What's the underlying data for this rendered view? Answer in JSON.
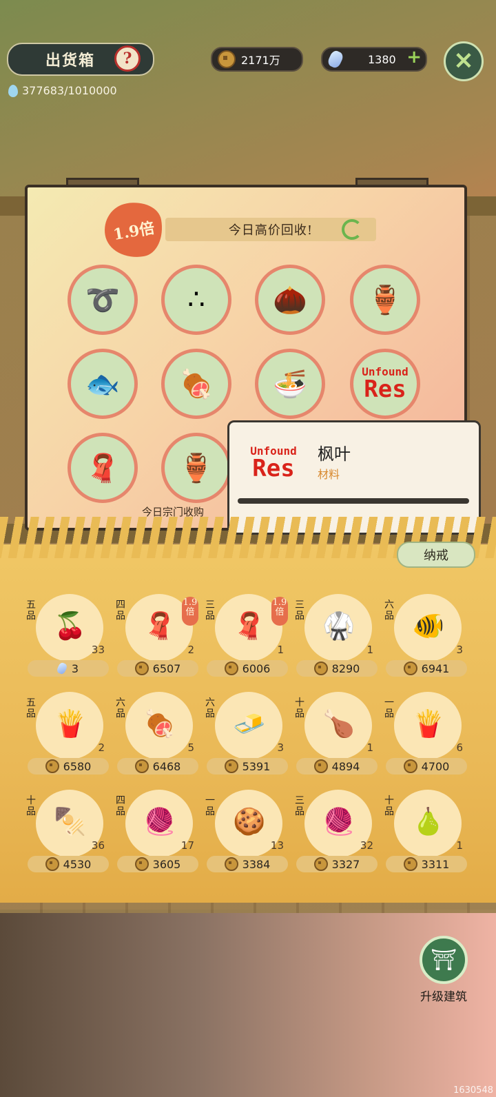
{
  "header": {
    "title": "出货箱",
    "help_glyph": "?",
    "water": "377683/1010000",
    "coins": "2171万",
    "gems": "1380",
    "add_glyph": "+",
    "close_glyph": "✕"
  },
  "board": {
    "multiplier": "1.9倍",
    "banner": "今日高价回收!",
    "footer": "今日宗门收购",
    "slots": [
      {
        "icon": "green-noodle-bundle-icon",
        "glyph": "➰"
      },
      {
        "icon": "rice-grains-icon",
        "glyph": "∴"
      },
      {
        "icon": "seeds-icon",
        "glyph": "🌰"
      },
      {
        "icon": "clay-jar-icon",
        "glyph": "🏺"
      },
      {
        "icon": "fish-fillet-icon",
        "glyph": "🐟"
      },
      {
        "icon": "braised-meat-dish-icon",
        "glyph": "🍖"
      },
      {
        "icon": "noodle-bowl-icon",
        "glyph": "🍜"
      },
      {
        "unfound_1": "Unfound",
        "unfound_2": "Res"
      },
      {
        "icon": "blue-cloth-icon",
        "glyph": "🧣"
      },
      {
        "icon": "wine-jar-icon",
        "glyph": "🏺"
      }
    ]
  },
  "tooltip": {
    "unfound_1": "Unfound",
    "unfound_2": "Res",
    "name": "枫叶",
    "type": "材料"
  },
  "storage": {
    "tab": "纳戒",
    "items": [
      {
        "grade": "五品",
        "icon": "red-berries-icon",
        "glyph": "🍒",
        "qty": "33",
        "price": "3",
        "currency": "gem"
      },
      {
        "grade": "四品",
        "icon": "blue-cloth-icon",
        "glyph": "🧣",
        "qty": "2",
        "price": "6507",
        "currency": "coin",
        "badge": "1.9倍"
      },
      {
        "grade": "三品",
        "icon": "blue-cloth-icon",
        "glyph": "🧣",
        "qty": "1",
        "price": "6006",
        "currency": "coin",
        "badge": "1.9倍"
      },
      {
        "grade": "三品",
        "icon": "robe-icon",
        "glyph": "🥋",
        "qty": "1",
        "price": "8290",
        "currency": "coin"
      },
      {
        "grade": "六品",
        "icon": "fish-dish-icon",
        "glyph": "🐠",
        "qty": "3",
        "price": "6941",
        "currency": "coin"
      },
      {
        "grade": "五品",
        "icon": "fried-strips-dish-icon",
        "glyph": "🍟",
        "qty": "2",
        "price": "6580",
        "currency": "coin"
      },
      {
        "grade": "六品",
        "icon": "spicy-meat-dish-icon",
        "glyph": "🍖",
        "qty": "5",
        "price": "6468",
        "currency": "coin"
      },
      {
        "grade": "六品",
        "icon": "tofu-dish-icon",
        "glyph": "🧈",
        "qty": "3",
        "price": "5391",
        "currency": "coin"
      },
      {
        "grade": "十品",
        "icon": "roast-box-icon",
        "glyph": "🍗",
        "qty": "1",
        "price": "4894",
        "currency": "coin"
      },
      {
        "grade": "一品",
        "icon": "fried-strips-dish-icon",
        "glyph": "🍟",
        "qty": "6",
        "price": "4700",
        "currency": "coin"
      },
      {
        "grade": "十品",
        "icon": "skewers-icon",
        "glyph": "🍢",
        "qty": "36",
        "price": "4530",
        "currency": "coin"
      },
      {
        "grade": "四品",
        "icon": "red-cloth-icon",
        "glyph": "🧶",
        "qty": "17",
        "price": "3605",
        "currency": "coin"
      },
      {
        "grade": "一品",
        "icon": "cookies-plate-icon",
        "glyph": "🍪",
        "qty": "13",
        "price": "3384",
        "currency": "coin"
      },
      {
        "grade": "三品",
        "icon": "red-cloth-icon",
        "glyph": "🧶",
        "qty": "32",
        "price": "3327",
        "currency": "coin"
      },
      {
        "grade": "十品",
        "icon": "gourd-icon",
        "glyph": "🍐",
        "qty": "1",
        "price": "3311",
        "currency": "coin"
      }
    ]
  },
  "upgrade": {
    "label": "升级建筑",
    "glyph": "⛩"
  },
  "watermark": "1630548"
}
